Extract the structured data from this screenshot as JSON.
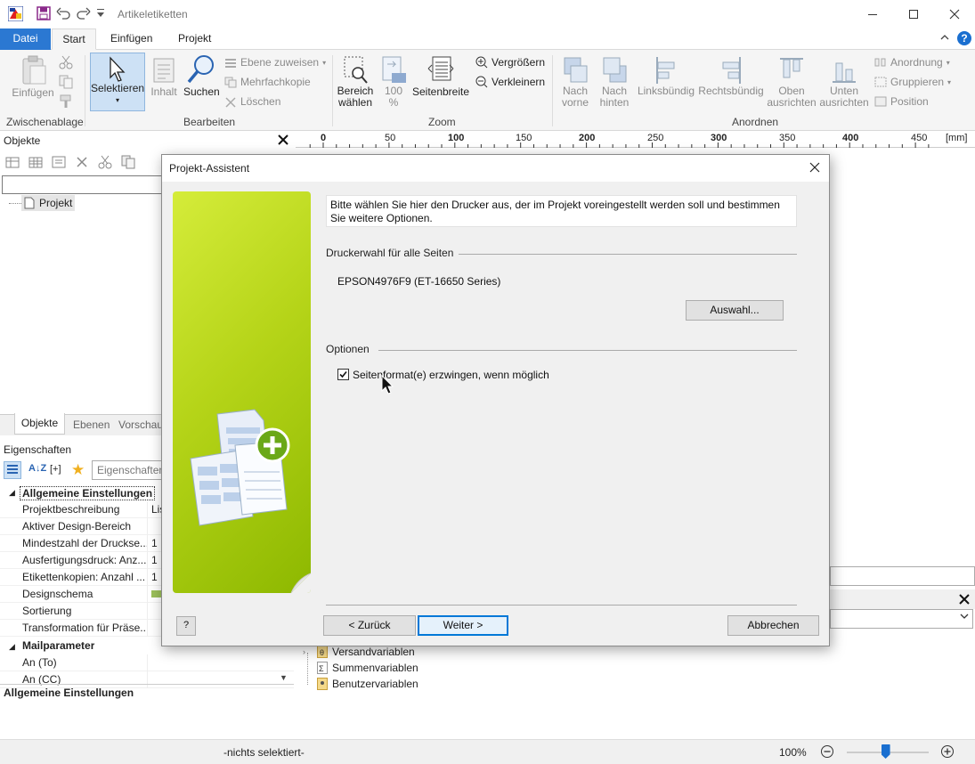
{
  "window": {
    "title": "Artikeletiketten"
  },
  "ribbon": {
    "tabs": [
      "Datei",
      "Start",
      "Einfügen",
      "Projekt"
    ],
    "einfuegen": "Einfügen",
    "selektieren": "Selektieren",
    "inhalt": "Inhalt",
    "suchen": "Suchen",
    "ebene_zuweisen": "Ebene zuweisen",
    "mehrfachkopie": "Mehrfachkopie",
    "loeschen": "Löschen",
    "bereich_1": "Bereich",
    "bereich_2": "wählen",
    "zoom100_1": "100",
    "zoom100_2": "%",
    "seitenbreite": "Seitenbreite",
    "vergroessern": "Vergrößern",
    "verkleinern": "Verkleinern",
    "nach_vorne_1": "Nach",
    "nach_vorne_2": "vorne",
    "nach_hinten_1": "Nach",
    "nach_hinten_2": "hinten",
    "linksbuendig": "Linksbündig",
    "rechtsbuendig": "Rechtsbündig",
    "oben_1": "Oben",
    "oben_2": "ausrichten",
    "unten_1": "Unten",
    "unten_2": "ausrichten",
    "anordnung": "Anordnung",
    "gruppieren": "Gruppieren",
    "position": "Position",
    "groups": {
      "zwischenablage": "Zwischenablage",
      "bearbeiten": "Bearbeiten",
      "zoom": "Zoom",
      "anordnen": "Anordnen"
    }
  },
  "objects_panel": {
    "title": "Objekte",
    "tree_root": "Projekt",
    "tabs": [
      "Objekte",
      "Ebenen",
      "Vorschau"
    ]
  },
  "properties": {
    "title": "Eigenschaften",
    "search_placeholder": "Eigenschaften",
    "section1": "Allgemeine Einstellungen",
    "rows": [
      {
        "name": "Projektbeschreibung",
        "value": "Lis"
      },
      {
        "name": "Aktiver Design-Bereich",
        "value": ""
      },
      {
        "name": "Mindestzahl der Druckse...",
        "value": "1"
      },
      {
        "name": "Ausfertigungsdruck: Anz...",
        "value": "1"
      },
      {
        "name": "Etikettenkopien: Anzahl ...",
        "value": "1"
      },
      {
        "name": "Designschema",
        "value": ""
      },
      {
        "name": "Sortierung",
        "value": ""
      },
      {
        "name": "Transformation für Präse...",
        "value": ""
      }
    ],
    "section2": "Mailparameter",
    "rows2": [
      {
        "name": "An (To)",
        "value": ""
      },
      {
        "name": "An (CC)",
        "value": ""
      }
    ],
    "footer": "Allgemeine Einstellungen"
  },
  "ruler": {
    "labels": [
      "0",
      "50",
      "100",
      "150",
      "200",
      "250",
      "300",
      "350",
      "400",
      "450"
    ],
    "unit": "[mm]"
  },
  "dialog": {
    "title": "Projekt-Assistent",
    "info": "Bitte wählen Sie hier den Drucker aus, der im Projekt voreingestellt werden soll und bestimmen Sie weitere Optionen.",
    "printer_section": "Druckerwahl für alle Seiten",
    "printer_name": "EPSON4976F9 (ET-16650 Series)",
    "auswahl": "Auswahl...",
    "options_section": "Optionen",
    "checkbox_label": "Seitenformat(e) erzwingen, wenn möglich",
    "checkbox_checked": true,
    "help": "?",
    "back": "< Zurück",
    "next": "Weiter >",
    "cancel": "Abbrechen"
  },
  "variables": [
    "Versandvariablen",
    "Summenvariablen",
    "Benutzervariablen"
  ],
  "status": {
    "selection": "-nichts selektiert-",
    "zoom": "100%",
    "zoom_level": 0.3
  }
}
